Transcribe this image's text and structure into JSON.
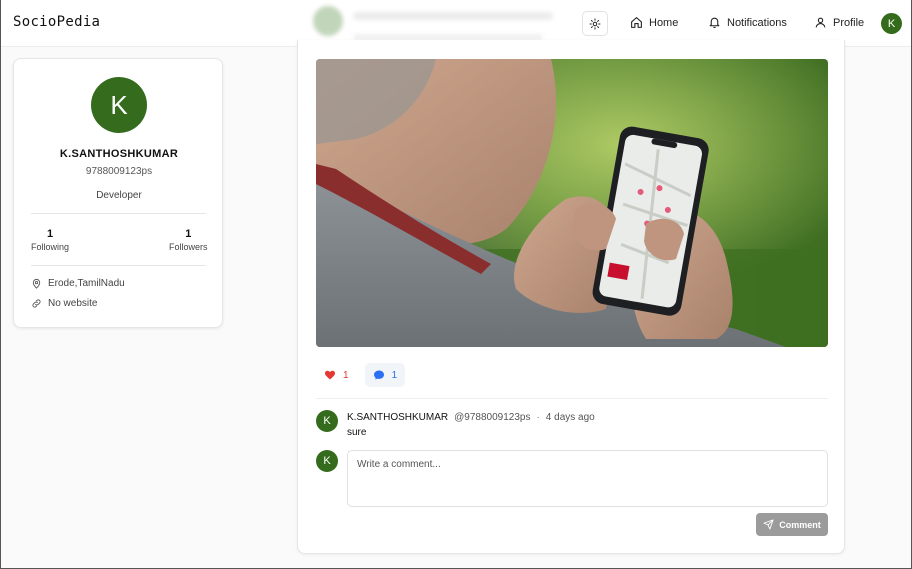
{
  "header": {
    "brand": "SocioPedia",
    "nav": {
      "home": "Home",
      "notifications": "Notifications",
      "profile": "Profile"
    },
    "avatar_initial": "K"
  },
  "profile_card": {
    "avatar_initial": "K",
    "name": "K.SANTHOSHKUMAR",
    "handle": "9788009123ps",
    "role": "Developer",
    "following": {
      "count": "1",
      "label": "Following"
    },
    "followers": {
      "count": "1",
      "label": "Followers"
    },
    "location": "Erode,TamilNadu",
    "website": "No website"
  },
  "post": {
    "likes": "1",
    "comments_count": "1",
    "comments": [
      {
        "avatar_initial": "K",
        "name": "K.SANTHOSHKUMAR",
        "handle": "@9788009123ps",
        "separator": "·",
        "time": "4 days ago",
        "text": "sure"
      }
    ],
    "composer": {
      "avatar_initial": "K",
      "placeholder": "Write a comment...",
      "button_label": "Comment"
    }
  },
  "colors": {
    "avatar_green": "#356b1d",
    "like_red": "#e53935",
    "comment_blue": "#2b6ff2",
    "disabled_button": "#9b9b9b"
  }
}
